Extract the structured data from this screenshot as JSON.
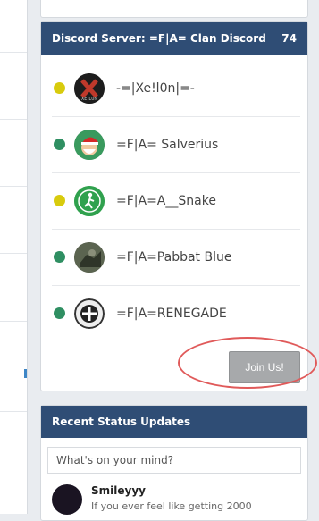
{
  "discord": {
    "title": "Discord Server: =F|A= Clan Discord",
    "count": "74",
    "colors": {
      "header_bg": "#2f4d75",
      "online": "#2f8f62",
      "idle": "#d8cb0d"
    },
    "members": [
      {
        "name": "-=|Xe!l0n|=-",
        "status": "idle",
        "avatar": "x-logo-avatar"
      },
      {
        "name": "=F|A= Salverius",
        "status": "online",
        "avatar": "santa-avatar"
      },
      {
        "name": "=F|A=A__Snake",
        "status": "idle",
        "avatar": "runner-avatar"
      },
      {
        "name": "=F|A=Pabbat Blue",
        "status": "online",
        "avatar": "soldier-avatar"
      },
      {
        "name": "=F|A=RENEGADE",
        "status": "online",
        "avatar": "emblem-avatar"
      }
    ],
    "join_label": "Join Us!"
  },
  "status_updates": {
    "title": "Recent Status Updates",
    "placeholder": "What's on your mind?",
    "items": [
      {
        "author": "Smileyyy",
        "text": "If you ever feel like getting 2000"
      }
    ]
  }
}
